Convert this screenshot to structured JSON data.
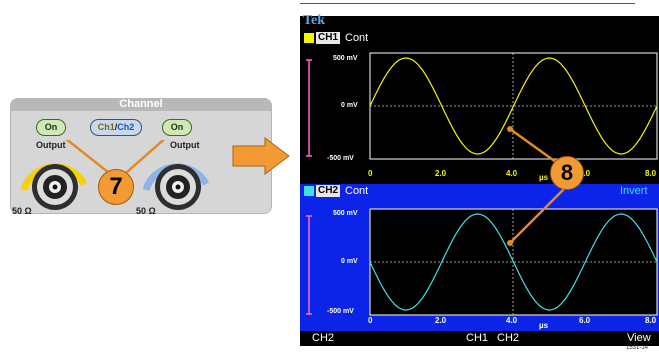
{
  "panel": {
    "title": "Channel",
    "on_left": "On",
    "ch_button": {
      "ch1": "Ch1",
      "sep": "/",
      "ch2": "Ch2"
    },
    "on_right": "On",
    "output_left": "Output",
    "output_right": "Output",
    "ohm_left": "50 Ω",
    "ohm_right": "50 Ω"
  },
  "callouts": {
    "seven": "7",
    "eight": "8"
  },
  "screen": {
    "brand": "Tek",
    "ch1": {
      "tag": "CH1",
      "mode": "Cont",
      "color": "#f5f500",
      "y_top": "500 mV",
      "y_mid": "0 mV",
      "y_bot": "-500 mV"
    },
    "ch2": {
      "tag": "CH2",
      "mode": "Cont",
      "status": "Invert",
      "color": "#40e0e8",
      "y_top": "500 mV",
      "y_mid": "0 mV",
      "y_bot": "-500 mV"
    },
    "x_ticks": [
      "0",
      "2.0",
      "4.0",
      "6.0",
      "8.0"
    ],
    "x_unit": "µs",
    "softkeys": {
      "left": "CH2",
      "mid1": "CH1",
      "mid2": "CH2",
      "right": "View"
    }
  },
  "figure_id": "1531-14"
}
